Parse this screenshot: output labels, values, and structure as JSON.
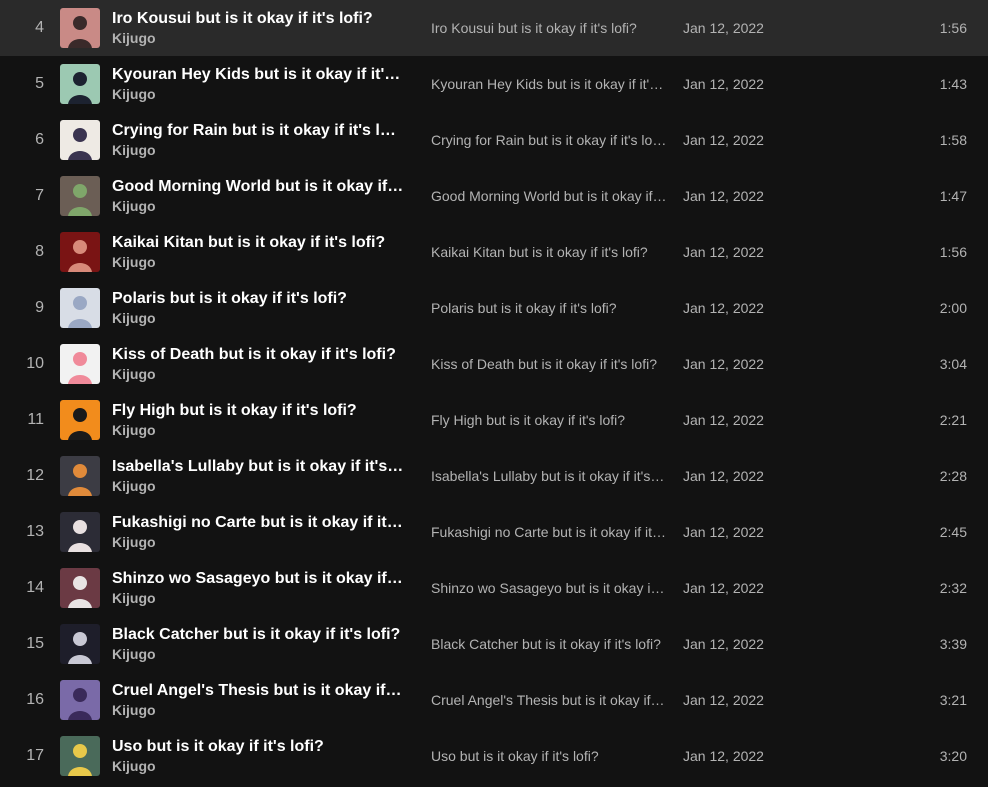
{
  "tracks": [
    {
      "number": "4",
      "title": "Iro Kousui but is it okay if it's lofi?",
      "artist": "Kijugo",
      "album": "Iro Kousui but is it okay if it's lofi?",
      "date_added": "Jan 12, 2022",
      "duration": "1:56",
      "cover_bg": "#c98a86",
      "cover_fg": "#3a2a2a"
    },
    {
      "number": "5",
      "title": "Kyouran Hey Kids but is it okay if it's lofi?",
      "artist": "Kijugo",
      "album": "Kyouran Hey Kids but is it okay if it's lofi?",
      "date_added": "Jan 12, 2022",
      "duration": "1:43",
      "cover_bg": "#9cc9b2",
      "cover_fg": "#1c2230"
    },
    {
      "number": "6",
      "title": "Crying for Rain but is it okay if it's lofi?",
      "artist": "Kijugo",
      "album": "Crying for Rain but is it okay if it's lofi?",
      "date_added": "Jan 12, 2022",
      "duration": "1:58",
      "cover_bg": "#eeeae4",
      "cover_fg": "#3a3450"
    },
    {
      "number": "7",
      "title": "Good Morning World but is it okay if it's lofi?",
      "artist": "Kijugo",
      "album": "Good Morning World but is it okay if it's lofi?",
      "date_added": "Jan 12, 2022",
      "duration": "1:47",
      "cover_bg": "#6b5e55",
      "cover_fg": "#7fa66a"
    },
    {
      "number": "8",
      "title": "Kaikai Kitan but is it okay if it's lofi?",
      "artist": "Kijugo",
      "album": "Kaikai Kitan but is it okay if it's lofi?",
      "date_added": "Jan 12, 2022",
      "duration": "1:56",
      "cover_bg": "#7a1414",
      "cover_fg": "#d88a7a"
    },
    {
      "number": "9",
      "title": "Polaris but is it okay if it's lofi?",
      "artist": "Kijugo",
      "album": "Polaris but is it okay if it's lofi?",
      "date_added": "Jan 12, 2022",
      "duration": "2:00",
      "cover_bg": "#d8dde6",
      "cover_fg": "#9aa8c4"
    },
    {
      "number": "10",
      "title": "Kiss of Death but is it okay if it's lofi?",
      "artist": "Kijugo",
      "album": "Kiss of Death but is it okay if it's lofi?",
      "date_added": "Jan 12, 2022",
      "duration": "3:04",
      "cover_bg": "#f2f2f2",
      "cover_fg": "#f08a9a"
    },
    {
      "number": "11",
      "title": "Fly High but is it okay if it's lofi?",
      "artist": "Kijugo",
      "album": "Fly High but is it okay if it's lofi?",
      "date_added": "Jan 12, 2022",
      "duration": "2:21",
      "cover_bg": "#f28c1c",
      "cover_fg": "#1a1a1a"
    },
    {
      "number": "12",
      "title": "Isabella's Lullaby but is it okay if it's lofi?",
      "artist": "Kijugo",
      "album": "Isabella's Lullaby but is it okay if it's lofi?",
      "date_added": "Jan 12, 2022",
      "duration": "2:28",
      "cover_bg": "#3c3c44",
      "cover_fg": "#e08a3a"
    },
    {
      "number": "13",
      "title": "Fukashigi no Carte but is it okay if it's lofi?",
      "artist": "Kijugo",
      "album": "Fukashigi no Carte but is it okay if it's lofi?",
      "date_added": "Jan 12, 2022",
      "duration": "2:45",
      "cover_bg": "#2c2c36",
      "cover_fg": "#e8e0e0"
    },
    {
      "number": "14",
      "title": "Shinzo wo Sasageyo but is it okay if it's lofi?",
      "artist": "Kijugo",
      "album": "Shinzo wo Sasageyo but is it okay if it's lofi?",
      "date_added": "Jan 12, 2022",
      "duration": "2:32",
      "cover_bg": "#6b3a44",
      "cover_fg": "#e8e4e4"
    },
    {
      "number": "15",
      "title": "Black Catcher but is it okay if it's lofi?",
      "artist": "Kijugo",
      "album": "Black Catcher but is it okay if it's lofi?",
      "date_added": "Jan 12, 2022",
      "duration": "3:39",
      "cover_bg": "#1e1e2a",
      "cover_fg": "#c8c8d4"
    },
    {
      "number": "16",
      "title": "Cruel Angel's Thesis but is it okay if it's lofi?",
      "artist": "Kijugo",
      "album": "Cruel Angel's Thesis but is it okay if it's lofi?",
      "date_added": "Jan 12, 2022",
      "duration": "3:21",
      "cover_bg": "#7a6aa8",
      "cover_fg": "#3a2a5a"
    },
    {
      "number": "17",
      "title": "Uso but is it okay if it's lofi?",
      "artist": "Kijugo",
      "album": "Uso but is it okay if it's lofi?",
      "date_added": "Jan 12, 2022",
      "duration": "3:20",
      "cover_bg": "#4a6a5a",
      "cover_fg": "#e8c84a"
    }
  ]
}
